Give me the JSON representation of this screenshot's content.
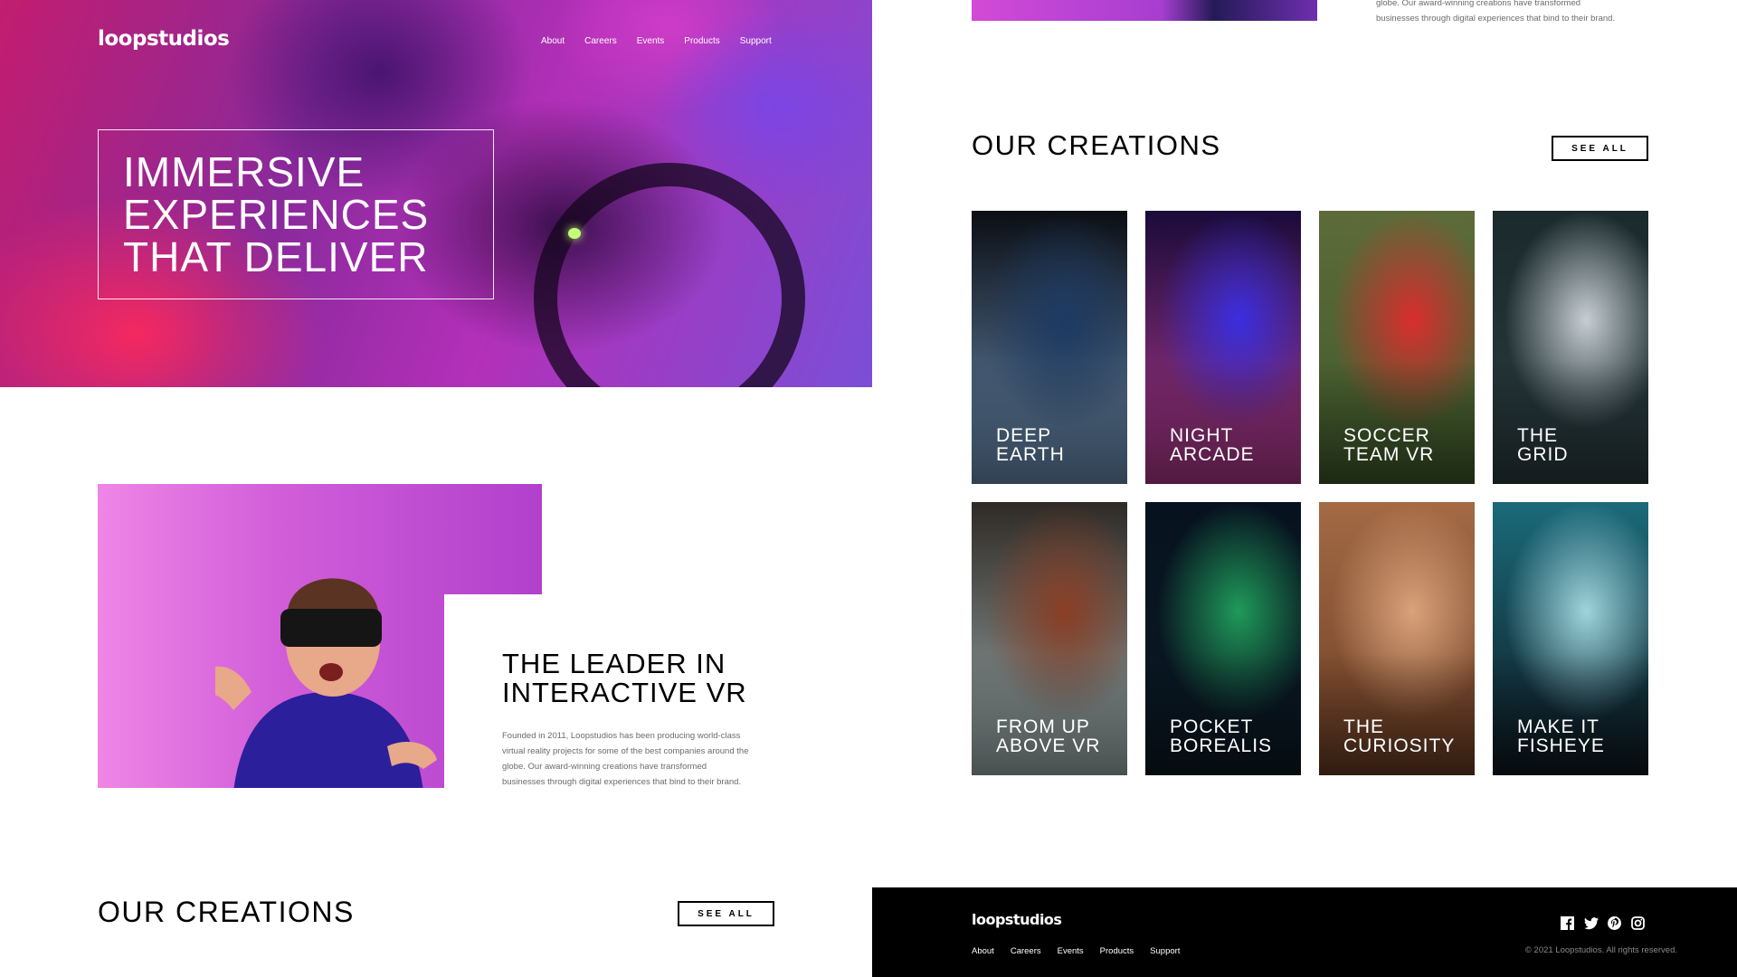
{
  "brand": {
    "logo": "loopstudios"
  },
  "hero": {
    "nav": [
      "About",
      "Careers",
      "Events",
      "Products",
      "Support"
    ],
    "headline": [
      "IMMERSIVE",
      "EXPERIENCES",
      "THAT DELIVER"
    ]
  },
  "leader": {
    "title": [
      "THE LEADER IN",
      "INTERACTIVE VR"
    ],
    "text": [
      "Founded in 2011, Loopstudios has been producing world-class",
      "virtual reality projects for some of the best companies around the",
      "globe. Our award-winning creations have transformed",
      "businesses through digital experiences that bind to their brand."
    ]
  },
  "top_right_text": [
    "globe. Our award-winning creations have transformed",
    "businesses through digital experiences that bind to their brand."
  ],
  "creations": {
    "title": "OUR CREATIONS",
    "see_all": "SEE ALL",
    "items": [
      {
        "lines": [
          "DEEP",
          "EARTH"
        ],
        "colors": [
          "#0b0e14",
          "#1d3a63",
          "#6c8fb4"
        ]
      },
      {
        "lines": [
          "NIGHT",
          "ARCADE"
        ],
        "colors": [
          "#1a0b3a",
          "#3b2ee0",
          "#b13a8c"
        ]
      },
      {
        "lines": [
          "SOCCER",
          "TEAM VR"
        ],
        "colors": [
          "#5d6b3a",
          "#d92d2d",
          "#3f5a2b"
        ]
      },
      {
        "lines": [
          "THE",
          "GRID"
        ],
        "colors": [
          "#1b2a2c",
          "#c7ced2",
          "#2a3b3e"
        ]
      },
      {
        "lines": [
          "FROM UP",
          "ABOVE VR"
        ],
        "colors": [
          "#2f2a26",
          "#8a3e24",
          "#9fb0b0"
        ]
      },
      {
        "lines": [
          "POCKET",
          "BOREALIS"
        ],
        "colors": [
          "#07121f",
          "#1f9a5a",
          "#0b1a24"
        ]
      },
      {
        "lines": [
          "THE",
          "CURIOSITY"
        ],
        "colors": [
          "#a36a45",
          "#d9a27b",
          "#6b3d24"
        ]
      },
      {
        "lines": [
          "MAKE IT",
          "FISHEYE"
        ],
        "colors": [
          "#1b6a7a",
          "#9fd4dc",
          "#0e1820"
        ]
      }
    ]
  },
  "bottom_creations": {
    "title": "OUR CREATIONS",
    "see_all": "SEE ALL"
  },
  "footer": {
    "logo": "loopstudios",
    "nav": [
      "About",
      "Careers",
      "Events",
      "Products",
      "Support"
    ],
    "socials": [
      "facebook-icon",
      "twitter-icon",
      "pinterest-icon",
      "instagram-icon"
    ],
    "copyright": "© 2021 Loopstudios. All rights reserved."
  }
}
